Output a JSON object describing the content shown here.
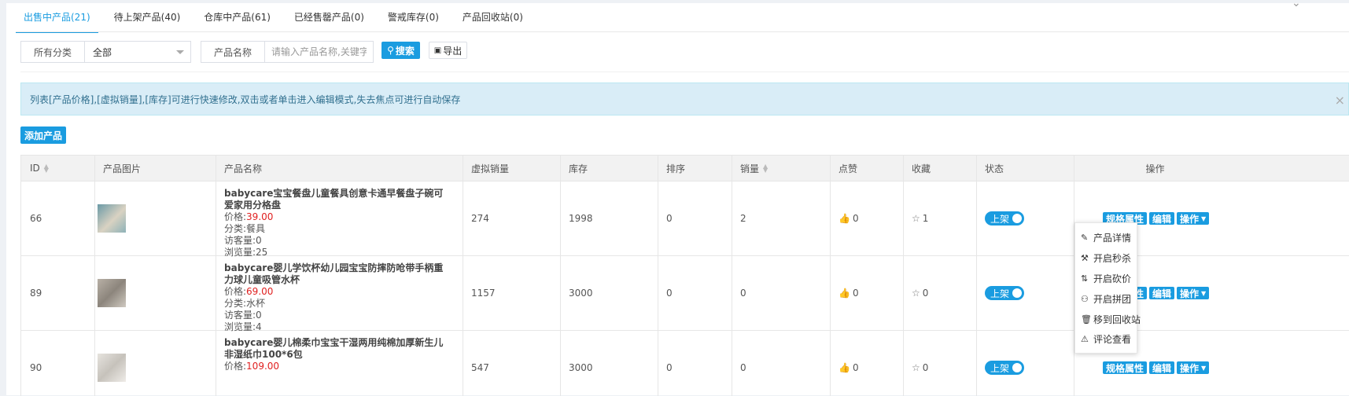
{
  "tabs": [
    {
      "label": "出售中产品(21)",
      "active": true
    },
    {
      "label": "待上架产品(40)",
      "active": false
    },
    {
      "label": "仓库中产品(61)",
      "active": false
    },
    {
      "label": "已经售罄产品(0)",
      "active": false
    },
    {
      "label": "警戒库存(0)",
      "active": false
    },
    {
      "label": "产品回收站(0)",
      "active": false
    }
  ],
  "filters": {
    "category_label": "所有分类",
    "category_value": "全部",
    "name_label": "产品名称",
    "name_placeholder": "请输入产品名称,关键字,编号",
    "search_label": "搜索",
    "export_label": "导出"
  },
  "alert": {
    "text": "列表[产品价格],[虚拟销量],[库存]可进行快速修改,双击或者单击进入编辑模式,失去焦点可进行自动保存",
    "close": "×"
  },
  "add_product_label": "添加产品",
  "table": {
    "headers": [
      "ID",
      "产品图片",
      "产品名称",
      "虚拟销量",
      "库存",
      "排序",
      "销量",
      "点赞",
      "收藏",
      "状态",
      "操作"
    ],
    "rows": [
      {
        "id": "66",
        "name": "babycare宝宝餐盘儿童餐具创意卡通早餐盘子碗可爱家用分格盘",
        "price_label": "价格:",
        "price": "39.00",
        "category": "分类:餐具",
        "visitors": "访客量:0",
        "views": "浏览量:25",
        "virtual_sales": "274",
        "stock": "1998",
        "sort": "0",
        "sales": "2",
        "likes": "0",
        "favorites": "1",
        "status": "上架"
      },
      {
        "id": "89",
        "name": "babycare婴儿学饮杯幼儿园宝宝防摔防呛带手柄重力球儿童吸管水杯",
        "price_label": "价格:",
        "price": "69.00",
        "category": "分类:水杯",
        "visitors": "访客量:0",
        "views": "浏览量:4",
        "virtual_sales": "1157",
        "stock": "3000",
        "sort": "0",
        "sales": "0",
        "likes": "0",
        "favorites": "0",
        "status": "上架"
      },
      {
        "id": "90",
        "name": "babycare婴儿棉柔巾宝宝干湿两用纯棉加厚新生儿非湿纸巾100*6包",
        "price_label": "价格:",
        "price": "109.00",
        "category": "",
        "visitors": "",
        "views": "",
        "virtual_sales": "547",
        "stock": "3000",
        "sort": "0",
        "sales": "0",
        "likes": "0",
        "favorites": "0",
        "status": "上架"
      }
    ],
    "op_labels": {
      "attr": "规格属性",
      "edit": "编辑",
      "ops": "操作"
    }
  },
  "dropdown": [
    {
      "icon": "pencil-icon",
      "glyph": "✎",
      "label": "产品详情"
    },
    {
      "icon": "gavel-icon",
      "glyph": "⚒",
      "label": "开启秒杀"
    },
    {
      "icon": "sort-amount-icon",
      "glyph": "⇅",
      "label": "开启砍价"
    },
    {
      "icon": "group-icon",
      "glyph": "⚇",
      "label": "开启拼团"
    },
    {
      "icon": "trash-icon",
      "glyph": "🗑",
      "label": "移到回收站"
    },
    {
      "icon": "warning-icon",
      "glyph": "⚠",
      "label": "评论查看"
    }
  ],
  "colors": {
    "accent": "#1a9ce0",
    "price": "#e02020",
    "alert_bg": "#d9edf7",
    "alert_text": "#31708f"
  }
}
